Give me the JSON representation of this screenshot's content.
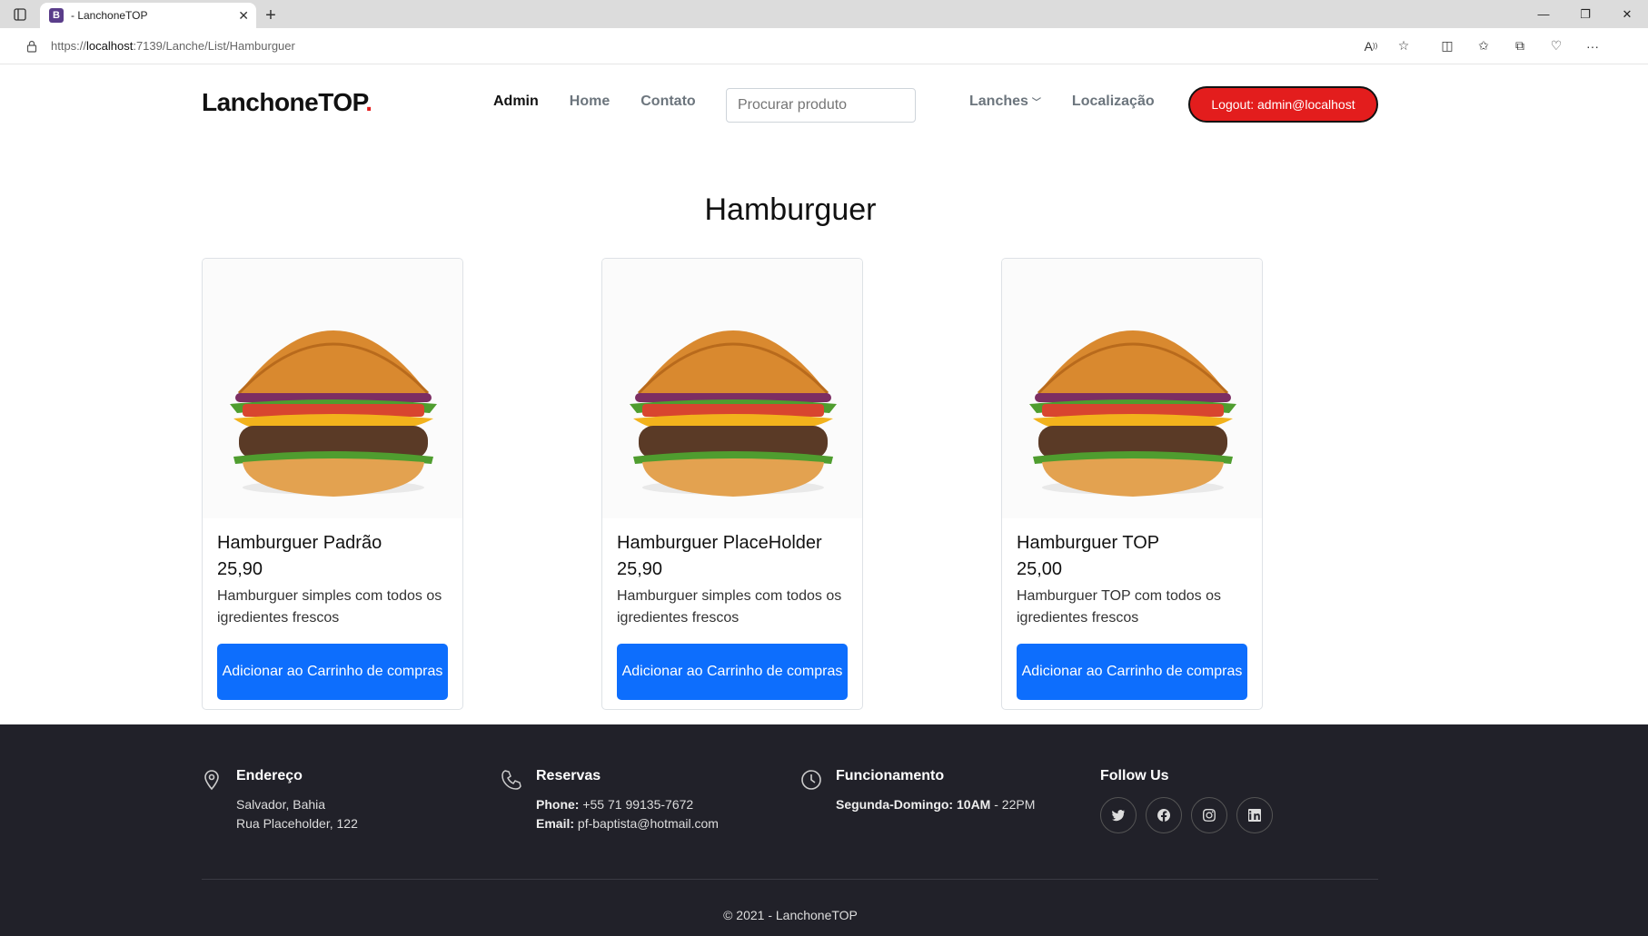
{
  "browser": {
    "tab_title": "- LanchoneTOP",
    "favicon_letter": "B",
    "url_prefix": "https://",
    "url_host": "localhost",
    "url_path": ":7139/Lanche/List/Hamburguer"
  },
  "header": {
    "brand": "LanchoneTOP",
    "brand_dot": ".",
    "nav": [
      "Admin",
      "Home",
      "Contato"
    ],
    "search_placeholder": "Procurar produto",
    "nav_right": [
      "Lanches",
      "Localização"
    ],
    "logout_label": "Logout: admin@localhost"
  },
  "main": {
    "title": "Hamburguer",
    "products": [
      {
        "name": "Hamburguer Padrão",
        "price": "25,90",
        "description": "Hamburguer simples com todos os igredientes frescos",
        "button": "Adicionar ao Carrinho de compras"
      },
      {
        "name": "Hamburguer PlaceHolder",
        "price": "25,90",
        "description": "Hamburguer simples com todos os igredientes frescos",
        "button": "Adicionar ao Carrinho de compras"
      },
      {
        "name": "Hamburguer TOP",
        "price": "25,00",
        "description": "Hamburguer TOP com todos os igredientes frescos",
        "button": "Adicionar ao Carrinho de compras"
      }
    ]
  },
  "footer": {
    "address": {
      "title": "Endereço",
      "line1": "Salvador, Bahia",
      "line2": "Rua Placeholder, 122"
    },
    "reservations": {
      "title": "Reservas",
      "phone_label": "Phone:",
      "phone": "+55 71 99135-7672",
      "email_label": "Email:",
      "email": "pf-baptista@hotmail.com"
    },
    "hours": {
      "title": "Funcionamento",
      "days": "Segunda-Domingo:",
      "open": "10AM",
      "close": "- 22PM"
    },
    "follow": {
      "title": "Follow Us"
    },
    "copyright": "© 2021 - LanchoneTOP"
  },
  "colors": {
    "brand_dot": "#e41c1c",
    "primary": "#0d6efd",
    "logout": "#e31d1d",
    "footer_bg": "#212129"
  }
}
